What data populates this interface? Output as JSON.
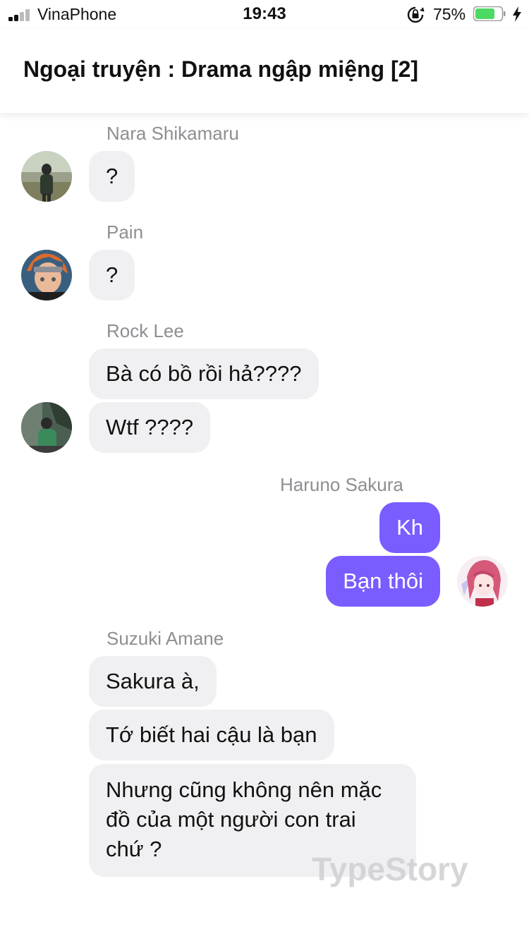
{
  "status_bar": {
    "carrier": "VinaPhone",
    "time": "19:43",
    "battery_percent": "75%",
    "battery_level": 0.75,
    "battery_color": "#4cd964"
  },
  "header": {
    "title": "Ngoại truyện : Drama ngập miệng [2]"
  },
  "colors": {
    "outgoing_bubble": "#7b5cff",
    "incoming_bubble": "#f0f0f2",
    "sender_name": "#8e8e93"
  },
  "messages": [
    {
      "sender": "Nara Shikamaru",
      "lines": [
        "?"
      ]
    },
    {
      "sender": "Pain",
      "lines": [
        "?"
      ]
    },
    {
      "sender": "Rock Lee",
      "lines": [
        "Bà có bồ rồi hả????",
        "Wtf ????"
      ]
    },
    {
      "sender": "Haruno Sakura",
      "lines": [
        "Kh",
        "Bạn thôi"
      ]
    },
    {
      "sender": "Suzuki Amane",
      "lines": [
        "Sakura à,",
        "Tớ biết hai cậu là bạn",
        "Nhưng cũng không nên mặc đồ của một người con trai chứ ?"
      ]
    }
  ],
  "watermark": "TypeStory"
}
